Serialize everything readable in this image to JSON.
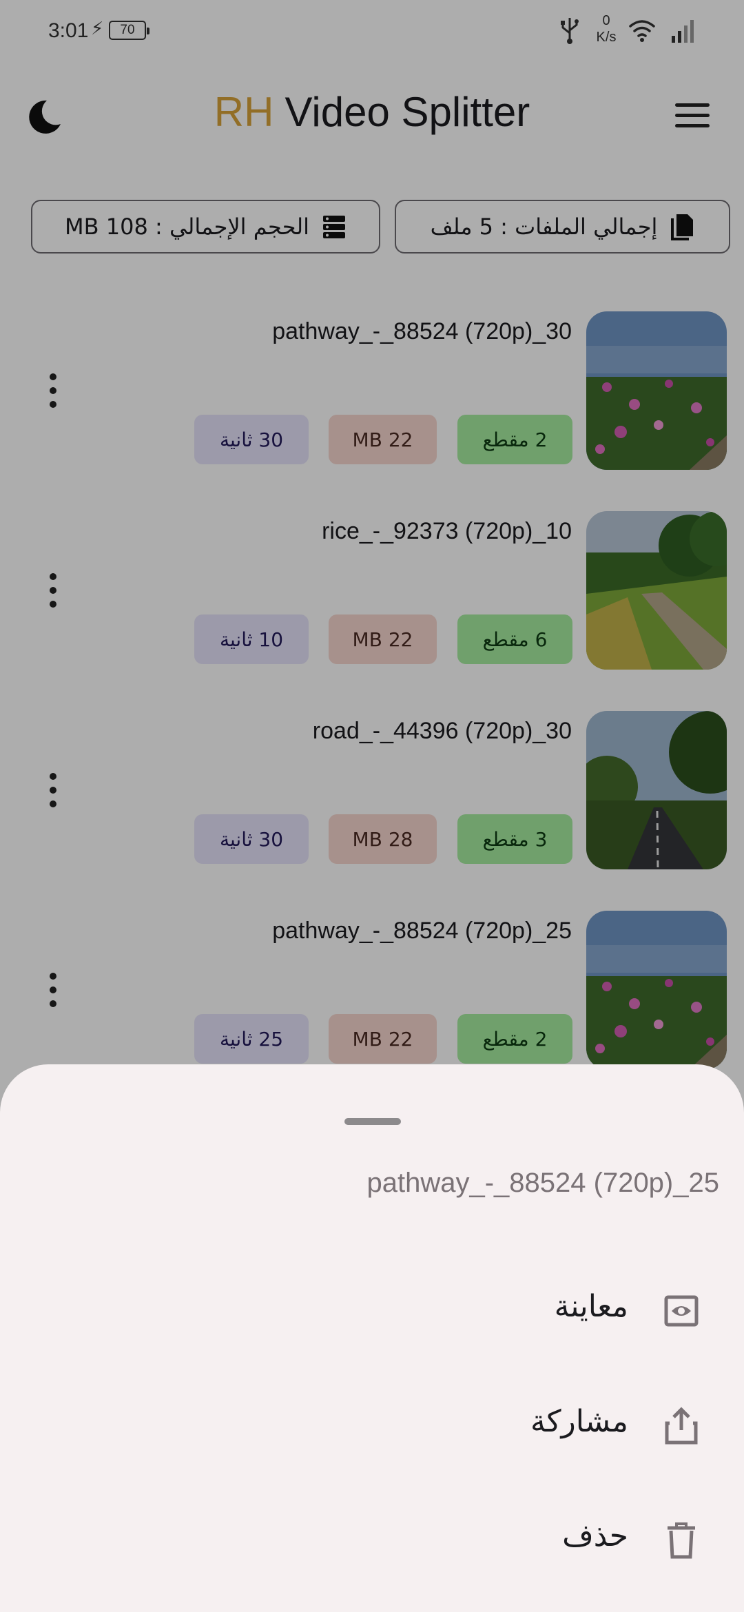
{
  "status_bar": {
    "time": "3:01",
    "battery": "70",
    "net_speed_value": "0",
    "net_speed_unit": "K/s",
    "icons": [
      "charging-bolt-icon",
      "usb-icon",
      "wifi-icon",
      "signal-icon"
    ]
  },
  "header": {
    "title_accent": "RH",
    "title_main": "Video Splitter",
    "accent_color": "#d8a23a",
    "theme_icon": "moon-icon",
    "menu_icon": "hamburger-menu-icon"
  },
  "summary": {
    "total_files": "إجمالي الملفات : 5 ملف",
    "total_size": "الحجم الإجمالي : 108 MB"
  },
  "videos": [
    {
      "name": "pathway_-_88524 (720p)_30",
      "segments": "2 مقطع",
      "size": "22 MB",
      "duration": "30 ثانية",
      "thumbnail": "flowers"
    },
    {
      "name": "rice_-_92373 (720p)_10",
      "segments": "6 مقطع",
      "size": "22 MB",
      "duration": "10 ثانية",
      "thumbnail": "field-path"
    },
    {
      "name": "road_-_44396 (720p)_30",
      "segments": "3 مقطع",
      "size": "28 MB",
      "duration": "30 ثانية",
      "thumbnail": "road"
    },
    {
      "name": "pathway_-_88524 (720p)_25",
      "segments": "2 مقطع",
      "size": "22 MB",
      "duration": "25 ثانية",
      "thumbnail": "flowers"
    }
  ],
  "sheet": {
    "title": "pathway_-_88524 (720p)_25",
    "actions": [
      {
        "label": "معاينة",
        "icon": "eye-preview-icon"
      },
      {
        "label": "مشاركة",
        "icon": "share-icon"
      },
      {
        "label": "حذف",
        "icon": "trash-icon"
      }
    ]
  }
}
